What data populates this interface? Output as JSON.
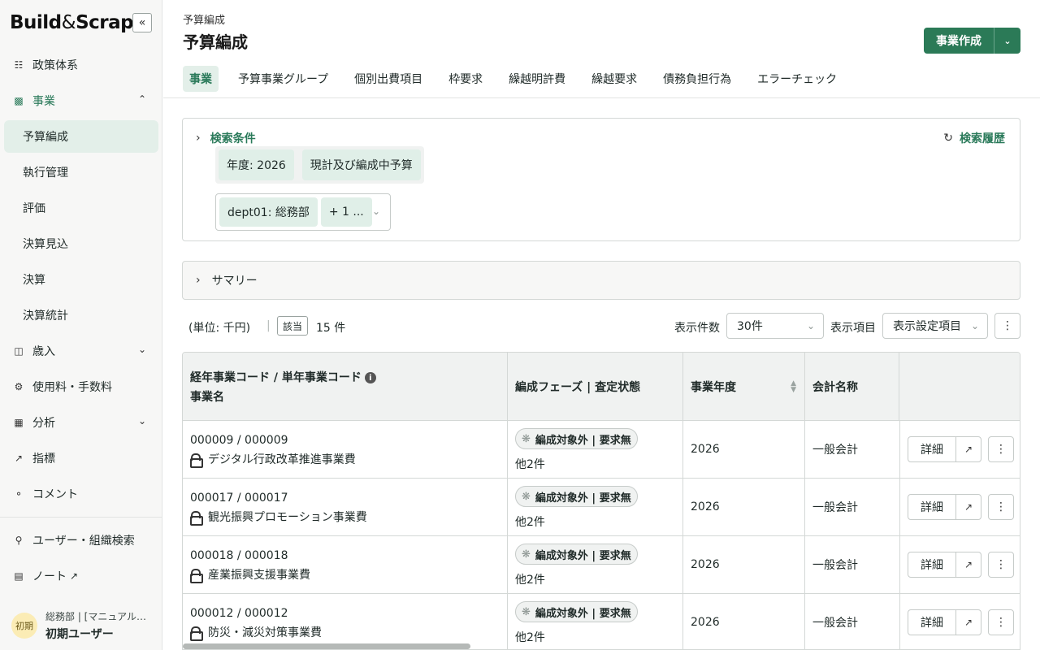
{
  "sidebar": {
    "brand": {
      "part1": "Build",
      "amp": "&",
      "part2": "Scrap"
    },
    "collapse_icon": "«",
    "items": [
      {
        "label": "政策体系",
        "icon": "hierarchy-icon"
      },
      {
        "label": "事業",
        "icon": "bar-chart-icon",
        "expanded": true
      },
      {
        "label": "歳入",
        "icon": "revenue-icon"
      },
      {
        "label": "使用料・手数料",
        "icon": "fee-icon"
      },
      {
        "label": "分析",
        "icon": "analysis-icon"
      },
      {
        "label": "指標",
        "icon": "trend-icon"
      },
      {
        "label": "コメント",
        "icon": "comment-icon"
      },
      {
        "label": "ユーザー・組織検索",
        "icon": "search-icon"
      },
      {
        "label": "ノート",
        "icon": "notebook-icon"
      }
    ],
    "sub_items": [
      "予算編成",
      "執行管理",
      "評価",
      "決算見込",
      "決算",
      "決算統計"
    ],
    "active_sub": "予算編成",
    "user": {
      "avatar": "初期",
      "org": "総務部 | [マニュアル…",
      "name": "初期ユーザー"
    }
  },
  "header": {
    "breadcrumb": "予算編成",
    "title": "予算編成",
    "create_label": "事業作成"
  },
  "tabs": [
    "事業",
    "予算事業グループ",
    "個別出費項目",
    "枠要求",
    "繰越明許費",
    "繰越要求",
    "債務負担行為",
    "エラーチェック"
  ],
  "search": {
    "toggle_label": "検索条件",
    "history_label": "検索履歴",
    "chips": [
      "年度: 2026",
      "現計及び編成中予算"
    ],
    "dept_chips": [
      "dept01: 総務部",
      "+ 1 ..."
    ]
  },
  "summary": {
    "label": "サマリー"
  },
  "toolbar": {
    "unit": "(単位: 千円)",
    "hit_badge": "該当",
    "hit_count": "15 件",
    "count_label": "表示件数",
    "count_value": "30件",
    "columns_label": "表示項目",
    "columns_value": "表示設定項目"
  },
  "table": {
    "headers": {
      "code_line1": "経年事業コード / 単年事業コード",
      "code_line2": "事業名",
      "phase": "編成フェーズ | 査定状態",
      "year": "事業年度",
      "account": "会計名称"
    },
    "detail_label": "詳細",
    "rows": [
      {
        "code": "000009 / 000009",
        "name": "デジタル行政改革推進事業費",
        "phase": "編成対象外 | 要求無",
        "more": "他2件",
        "year": "2026",
        "account": "一般会計"
      },
      {
        "code": "000017 / 000017",
        "name": "観光振興プロモーション事業費",
        "phase": "編成対象外 | 要求無",
        "more": "他2件",
        "year": "2026",
        "account": "一般会計"
      },
      {
        "code": "000018 / 000018",
        "name": "産業振興支援事業費",
        "phase": "編成対象外 | 要求無",
        "more": "他2件",
        "year": "2026",
        "account": "一般会計"
      },
      {
        "code": "000012 / 000012",
        "name": "防災・減災対策事業費",
        "phase": "編成対象外 | 要求無",
        "more": "他2件",
        "year": "2026",
        "account": "一般会計"
      }
    ]
  },
  "colors": {
    "accent": "#2b7a57",
    "active_bg": "#e3efe9"
  }
}
